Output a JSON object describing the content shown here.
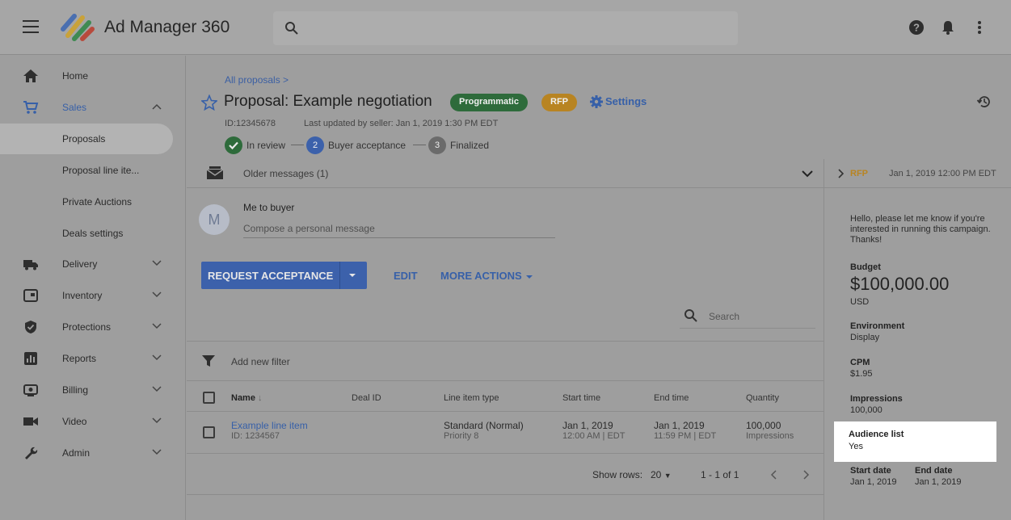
{
  "header": {
    "app_title": "Ad Manager 360",
    "search_placeholder": ""
  },
  "sidebar": {
    "items": [
      {
        "label": "Home",
        "icon": "home-icon"
      },
      {
        "label": "Sales",
        "icon": "cart-icon",
        "expanded": true
      },
      {
        "label": "Proposals",
        "selected": true
      },
      {
        "label": "Proposal line ite..."
      },
      {
        "label": "Private Auctions"
      },
      {
        "label": "Deals settings"
      },
      {
        "label": "Delivery",
        "icon": "truck-icon"
      },
      {
        "label": "Inventory",
        "icon": "inventory-icon"
      },
      {
        "label": "Protections",
        "icon": "shield-icon"
      },
      {
        "label": "Reports",
        "icon": "reports-icon"
      },
      {
        "label": "Billing",
        "icon": "billing-icon"
      },
      {
        "label": "Video",
        "icon": "video-icon"
      },
      {
        "label": "Admin",
        "icon": "wrench-icon"
      }
    ]
  },
  "proposal": {
    "breadcrumb": "All proposals >",
    "title": "Proposal: Example negotiation",
    "badges": {
      "programmatic": "Programmatic",
      "rfp": "RFP"
    },
    "settings_label": "Settings",
    "id": "ID:12345678",
    "last_updated": "Last updated by seller: Jan 1, 2019 1:30 PM EDT",
    "steps": [
      {
        "num": "",
        "label": "In review",
        "state": "done"
      },
      {
        "num": "2",
        "label": "Buyer acceptance",
        "state": "current"
      },
      {
        "num": "3",
        "label": "Finalized",
        "state": "pending"
      }
    ]
  },
  "messages": {
    "older": "Older messages (1)",
    "avatar_letter": "M",
    "recipient": "Me to buyer",
    "compose_placeholder": "Compose a personal message"
  },
  "actions": {
    "request_acceptance": "REQUEST ACCEPTANCE",
    "edit": "EDIT",
    "more_actions": "MORE ACTIONS"
  },
  "table": {
    "search_placeholder": "Search",
    "filter_label": "Add new filter",
    "columns": {
      "name": "Name",
      "deal_id": "Deal ID",
      "line_item_type": "Line item type",
      "start_time": "Start time",
      "end_time": "End time",
      "quantity": "Quantity"
    },
    "rows": [
      {
        "name": "Example line item",
        "id": "ID: 1234567",
        "deal_id": "",
        "type": "Standard (Normal)",
        "priority": "Priority 8",
        "start_date": "Jan 1, 2019",
        "start_time": "12:00 AM | EDT",
        "end_date": "Jan 1, 2019",
        "end_time": "11:59 PM | EDT",
        "quantity": "100,000",
        "quantity_unit": "Impressions"
      }
    ],
    "footer": {
      "show_rows_label": "Show rows:",
      "rows_value": "20",
      "range": "1 - 1 of 1"
    }
  },
  "rfp_panel": {
    "tag": "RFP",
    "date": "Jan 1, 2019 12:00 PM EDT",
    "message": "Hello, please let me know if you're interested in running this campaign. Thanks!",
    "budget_label": "Budget",
    "budget_value": "$100,000.00",
    "budget_currency": "USD",
    "environment_label": "Environment",
    "environment_value": "Display",
    "cpm_label": "CPM",
    "cpm_value": "$1.95",
    "impressions_label": "Impressions",
    "impressions_value": "100,000",
    "audience_label": "Audience list",
    "audience_value": "Yes",
    "start_label": "Start date",
    "start_value": "Jan 1, 2019",
    "end_label": "End date",
    "end_value": "Jan 1, 2019"
  },
  "colors": {
    "accent_blue": "#3760a8",
    "programmatic_green": "#2e6b3b",
    "rfp_orange": "#b88422"
  }
}
